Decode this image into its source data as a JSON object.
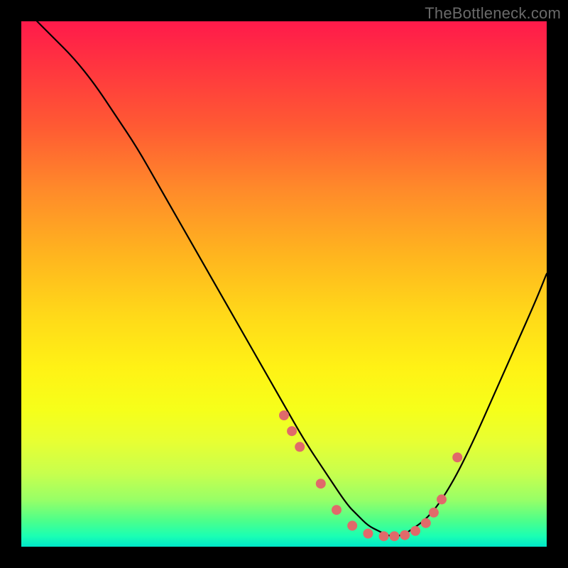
{
  "watermark": "TheBottleneck.com",
  "colors": {
    "frame": "#000000",
    "marker": "#e06a6a",
    "curve": "#000000"
  },
  "chart_data": {
    "type": "line",
    "title": "",
    "xlabel": "",
    "ylabel": "",
    "xlim": [
      0,
      100
    ],
    "ylim": [
      0,
      100
    ],
    "grid": false,
    "legend": false,
    "annotation": "TheBottleneck.com",
    "series": [
      {
        "name": "curve",
        "x": [
          3,
          6,
          10,
          14,
          18,
          22,
          26,
          30,
          34,
          38,
          42,
          46,
          50,
          54,
          58,
          62,
          64,
          66,
          68,
          70,
          72,
          74,
          78,
          82,
          86,
          90,
          94,
          98,
          100
        ],
        "y": [
          100,
          97,
          93,
          88,
          82,
          76,
          69,
          62,
          55,
          48,
          41,
          34,
          27,
          20,
          14,
          8,
          6,
          4,
          3,
          2,
          2,
          3,
          6,
          12,
          20,
          29,
          38,
          47,
          52
        ]
      }
    ],
    "markers": {
      "name": "dotted-region",
      "x": [
        50,
        51.5,
        53,
        57,
        60,
        63,
        66,
        69,
        71,
        73,
        75,
        77,
        78.5,
        80,
        83
      ],
      "y": [
        25,
        22,
        19,
        12,
        7,
        4,
        2.5,
        2,
        2,
        2.2,
        3,
        4.5,
        6.5,
        9,
        17
      ]
    }
  }
}
